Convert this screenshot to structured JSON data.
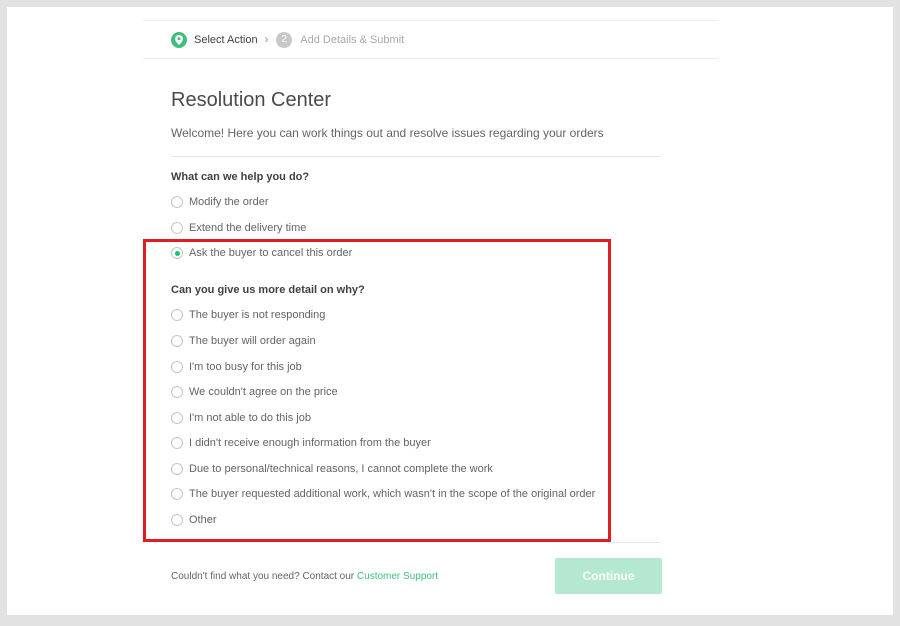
{
  "stepper": {
    "steps": [
      {
        "label": "Select Action",
        "state": "active",
        "icon": "map-pin-icon"
      },
      {
        "label": "Add Details & Submit",
        "state": "pending",
        "number": "2"
      }
    ],
    "separator": "›"
  },
  "page": {
    "title": "Resolution Center",
    "subtitle": "Welcome! Here you can work things out and resolve issues regarding your orders"
  },
  "action_question": {
    "heading": "What can we help you do?",
    "options": [
      {
        "label": "Modify the order",
        "checked": false
      },
      {
        "label": "Extend the delivery time",
        "checked": false
      },
      {
        "label": "Ask the buyer to cancel this order",
        "checked": true
      }
    ]
  },
  "reason_question": {
    "heading": "Can you give us more detail on why?",
    "options": [
      {
        "label": "The buyer is not responding",
        "checked": false
      },
      {
        "label": "The buyer will order again",
        "checked": false
      },
      {
        "label": "I'm too busy for this job",
        "checked": false
      },
      {
        "label": "We couldn't agree on the price",
        "checked": false
      },
      {
        "label": "I'm not able to do this job",
        "checked": false
      },
      {
        "label": "I didn't receive enough information from the buyer",
        "checked": false
      },
      {
        "label": "Due to personal/technical reasons, I cannot complete the work",
        "checked": false
      },
      {
        "label": "The buyer requested additional work, which wasn't in the scope of the original order",
        "checked": false
      },
      {
        "label": "Other",
        "checked": false
      }
    ]
  },
  "footer": {
    "text": "Couldn't find what you need? Contact our ",
    "link_label": "Customer Support",
    "continue_label": "Continue",
    "continue_disabled": true
  },
  "colors": {
    "accent": "#1dbf73",
    "highlight": "#e31b23",
    "button_disabled": "#b4e8d0"
  }
}
